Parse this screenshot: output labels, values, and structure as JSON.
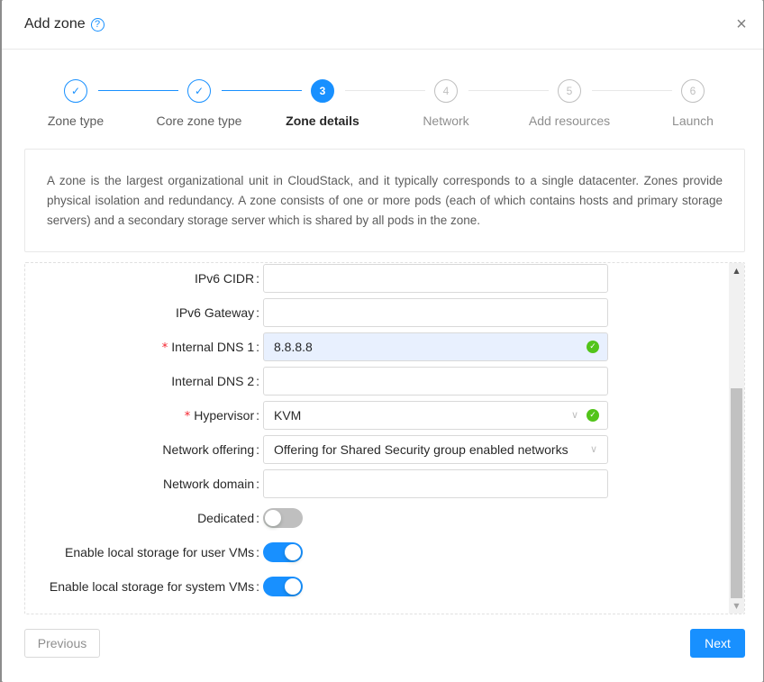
{
  "modal": {
    "title": "Add zone",
    "help_icon": "?",
    "close_icon": "×"
  },
  "steps": [
    {
      "label": "Zone type",
      "state": "done",
      "icon": "✓"
    },
    {
      "label": "Core zone type",
      "state": "done",
      "icon": "✓"
    },
    {
      "label": "Zone details",
      "state": "active",
      "icon": "3"
    },
    {
      "label": "Network",
      "state": "wait",
      "icon": "4"
    },
    {
      "label": "Add resources",
      "state": "wait",
      "icon": "5"
    },
    {
      "label": "Launch",
      "state": "wait",
      "icon": "6"
    }
  ],
  "description": "A zone is the largest organizational unit in CloudStack, and it typically corresponds to a single datacenter. Zones provide physical isolation and redundancy. A zone consists of one or more pods (each of which contains hosts and primary storage servers) and a secondary storage server which is shared by all pods in the zone.",
  "form": {
    "required_mark": "*",
    "colon": ":",
    "ipv6_cidr": {
      "label": "IPv6 CIDR",
      "value": ""
    },
    "ipv6_gateway": {
      "label": "IPv6 Gateway",
      "value": ""
    },
    "internal_dns1": {
      "label": "Internal DNS 1",
      "value": "8.8.8.8",
      "required": true
    },
    "internal_dns2": {
      "label": "Internal DNS 2",
      "value": ""
    },
    "hypervisor": {
      "label": "Hypervisor",
      "value": "KVM",
      "required": true
    },
    "network_offering": {
      "label": "Network offering",
      "value": "Offering for Shared Security group enabled networks"
    },
    "network_domain": {
      "label": "Network domain",
      "value": ""
    },
    "dedicated": {
      "label": "Dedicated",
      "on": false
    },
    "local_storage_user": {
      "label": "Enable local storage for user VMs",
      "on": true
    },
    "local_storage_system": {
      "label": "Enable local storage for system VMs",
      "on": true
    }
  },
  "icons": {
    "check": "✓",
    "chevron": "∨",
    "scroll_up": "▲",
    "scroll_down": "▼"
  },
  "footer": {
    "previous_label": "Previous",
    "next_label": "Next"
  },
  "colors": {
    "primary": "#1890ff",
    "success": "#52c41a",
    "required": "#f5222d"
  }
}
